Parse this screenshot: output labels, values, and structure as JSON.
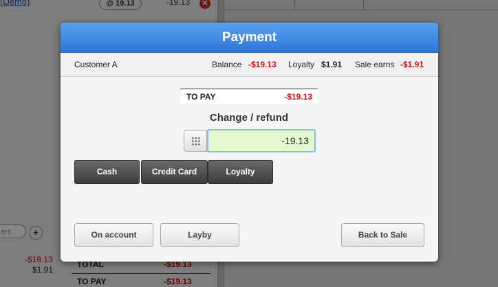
{
  "background": {
    "product_link": "(Demo)",
    "product_qty": "@ 19.13",
    "product_price": "-19.13",
    "search_placeholder": "ers",
    "plus_label": "+",
    "subtotal_negative": "-$19.13",
    "subtotal_positive": "$1.91",
    "total_label": "TOTAL",
    "total_value": "-$19.13",
    "topay_label": "TO PAY",
    "topay_value": "-$19.13"
  },
  "modal": {
    "title": "Payment",
    "info": {
      "customer": "Customer A",
      "balance_label": "Balance",
      "balance_value": "-$19.13",
      "loyalty_label": "Loyalty",
      "loyalty_value": "$1.91",
      "sale_earns_label": "Sale earns",
      "sale_earns_value": "-$1.91"
    },
    "to_pay": {
      "label": "TO PAY",
      "value": "-$19.13"
    },
    "change_label": "Change / refund",
    "amount": {
      "value": "-19.13"
    },
    "payment_methods": [
      "Cash",
      "Credit Card",
      "Loyalty"
    ],
    "actions": {
      "on_account": "On account",
      "layby": "Layby",
      "back_to_sale": "Back to Sale"
    }
  },
  "colors": {
    "header_top": "#5aa0ee",
    "header_bottom": "#2f77d8",
    "negative": "#d01010",
    "input_bg": "#e4fad2"
  }
}
